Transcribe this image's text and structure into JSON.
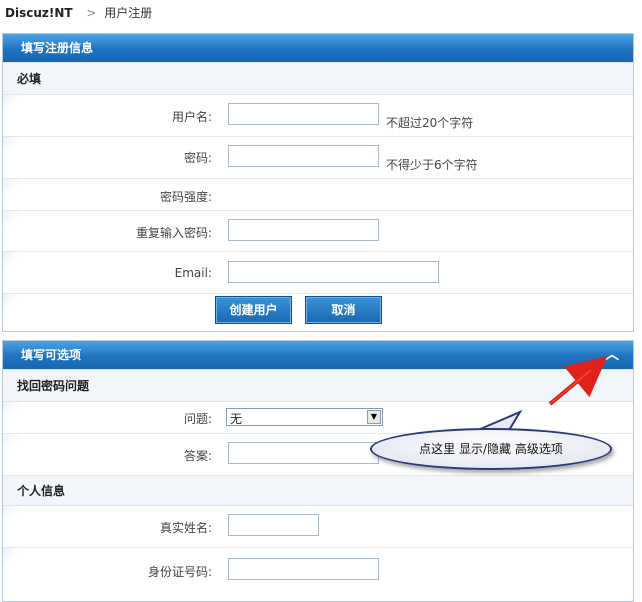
{
  "breadcrumb": {
    "site": "Discuz!NT",
    "separator": ">",
    "page": "用户注册"
  },
  "required_panel": {
    "title": "填写注册信息",
    "section_label": "必填",
    "fields": {
      "username": {
        "label": "用户名:",
        "value": "",
        "hint": "不超过20个字符"
      },
      "password": {
        "label": "密码:",
        "value": "",
        "hint": "不得少于6个字符"
      },
      "strength": {
        "label": "密码强度:"
      },
      "repeat_password": {
        "label": "重复输入密码:",
        "value": ""
      },
      "email": {
        "label": "Email:",
        "value": ""
      }
    },
    "buttons": {
      "create": "创建用户",
      "cancel": "取消"
    }
  },
  "optional_panel": {
    "title": "填写可选项",
    "collapse_icon": "chevron-up-icon",
    "recover_section": "找回密码问题",
    "question": {
      "label": "问题:",
      "selected": "无"
    },
    "answer": {
      "label": "答案:",
      "value": ""
    },
    "personal_section": "个人信息",
    "real_name": {
      "label": "真实姓名:",
      "value": ""
    },
    "id_number": {
      "label": "身份证号码:",
      "value": ""
    }
  },
  "annotation": {
    "text": "点这里 显示/隐藏 高级选项",
    "arrow_color": "#e0201a"
  }
}
